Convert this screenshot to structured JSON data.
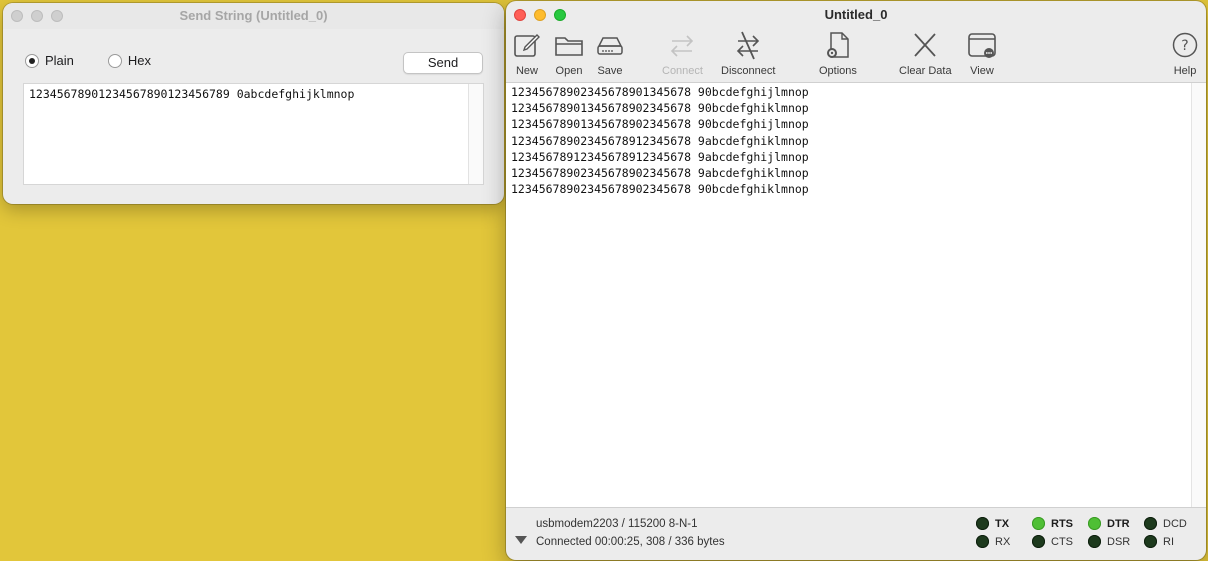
{
  "send_window": {
    "title": "Send String (Untitled_0)",
    "mode_plain_label": "Plain",
    "mode_hex_label": "Hex",
    "selected_mode": "Plain",
    "send_label": "Send",
    "text_value": "12345678901234567890123456789 0abcdefghijklmnop"
  },
  "main_window": {
    "title": "Untitled_0",
    "toolbar": {
      "new": "New",
      "open": "Open",
      "save": "Save",
      "connect": "Connect",
      "disconnect": "Disconnect",
      "options": "Options",
      "clear_data": "Clear Data",
      "view": "View",
      "help": "Help"
    },
    "terminal_lines": [
      "12345678902345678901345678 90bcdefghijlmnop",
      "12345678901345678902345678 90bcdefghiklmnop",
      "12345678901345678902345678 90bcdefghijlmnop",
      "12345678902345678912345678 9abcdefghiklmnop",
      "12345678912345678912345678 9abcdefghijlmnop",
      "12345678902345678902345678 9abcdefghiklmnop",
      "12345678902345678902345678 90bcdefghiklmnop"
    ],
    "status": {
      "port_line": "usbmodem2203 / 115200 8-N-1",
      "connection_line": "Connected 00:00:25, 308 / 336 bytes"
    },
    "signals": [
      {
        "label": "TX",
        "on": false,
        "bold": true
      },
      {
        "label": "RX",
        "on": false,
        "bold": false
      },
      {
        "label": "RTS",
        "on": true,
        "bold": true
      },
      {
        "label": "CTS",
        "on": false,
        "bold": false
      },
      {
        "label": "DTR",
        "on": true,
        "bold": true
      },
      {
        "label": "DSR",
        "on": false,
        "bold": false
      },
      {
        "label": "DCD",
        "on": false,
        "bold": false
      },
      {
        "label": "RI",
        "on": false,
        "bold": false
      }
    ]
  }
}
